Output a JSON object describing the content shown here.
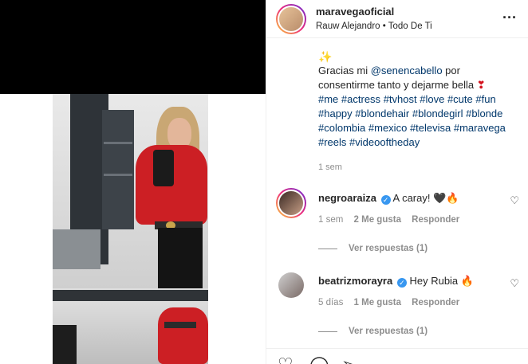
{
  "post": {
    "username": "maravegaoficial",
    "audio": "Rauw Alejandro • Todo De Ti",
    "more_icon": "more-horizontal-icon"
  },
  "caption": {
    "sparkle": "✨",
    "text_1": "Gracias mi ",
    "mention": "@senencabello",
    "text_2": " por consentirme tanto y dejarme bella ",
    "heart": "❣",
    "hashtags": [
      "#me",
      "#actress",
      "#tvhost",
      "#love",
      "#cute",
      "#fun",
      "#happy",
      "#blondehair",
      "#blondegirl",
      "#blonde",
      "#colombia",
      "#mexico",
      "#televisa",
      "#maravega",
      "#reels",
      "#videooftheday"
    ],
    "time": "1 sem"
  },
  "comments": [
    {
      "username": "negroaraiza",
      "verified": true,
      "text": "A caray! 🖤🔥",
      "time": "1 sem",
      "likes": "2 Me gusta",
      "reply": "Responder",
      "view_replies": "Ver respuestas (1)"
    },
    {
      "username": "beatrizmorayra",
      "verified": true,
      "text": "Hey Rubia 🔥",
      "time": "5 días",
      "likes": "1 Me gusta",
      "reply": "Responder",
      "view_replies": "Ver respuestas (1)"
    }
  ],
  "colors": {
    "link": "#00376b",
    "muted": "#8e8e8e",
    "verified": "#3897f0"
  }
}
